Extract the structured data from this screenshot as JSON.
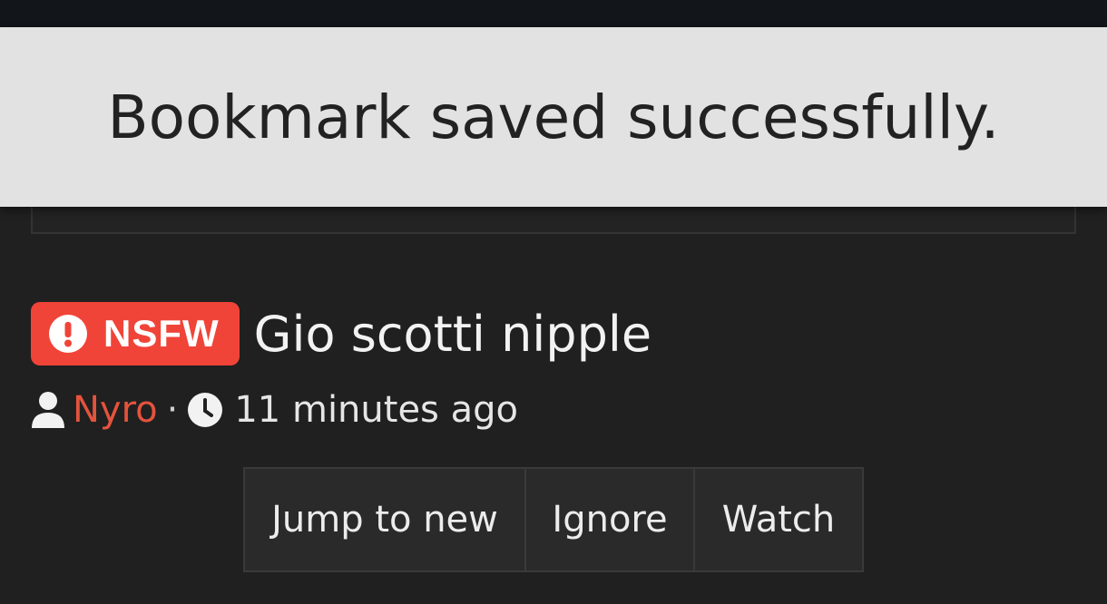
{
  "toast": {
    "message": "Bookmark saved successfully."
  },
  "thread": {
    "badge_label": "NSFW",
    "title": "Gio scotti nipple",
    "author": "Nyro",
    "separator": "·",
    "time_ago": "11 minutes ago"
  },
  "actions": {
    "jump_label": "Jump to new",
    "ignore_label": "Ignore",
    "watch_label": "Watch"
  },
  "colors": {
    "badge_bg": "#f04438",
    "author": "#e5533d",
    "toast_bg": "#e2e2e2",
    "page_bg": "#202020"
  },
  "icons": {
    "badge": "exclamation-circle-icon",
    "author": "user-icon",
    "time": "clock-icon",
    "menu": "hamburger-icon",
    "search": "search-icon"
  }
}
